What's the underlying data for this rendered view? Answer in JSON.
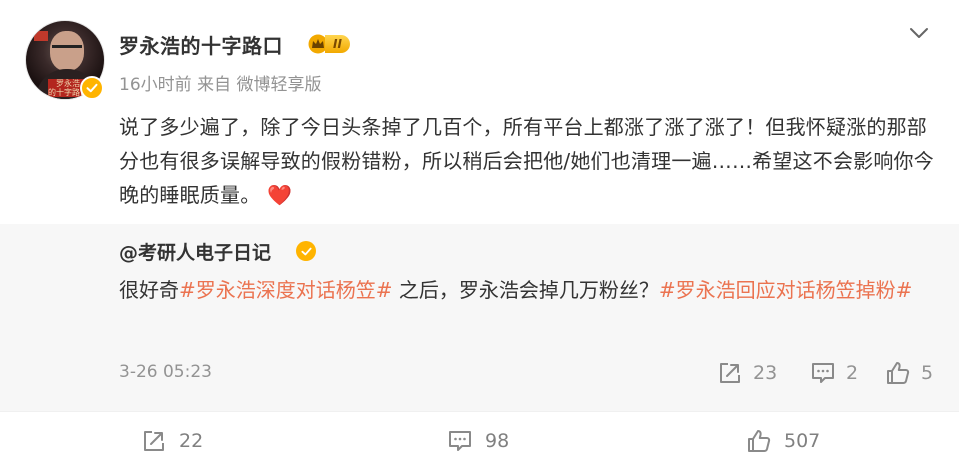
{
  "post": {
    "author": "罗永浩的十字路口",
    "vip_level": "II",
    "avatar_caption": "罗永浩\n的十字路口",
    "time": "16小时前",
    "source": "来自 微博轻享版",
    "text": "说了多少遍了，除了今日头条掉了几百个，所有平台上都涨了涨了涨了！但我怀疑涨的那部分也有很多误解导致的假粉错粉，所以稍后会把他/她们也清理一遍……希望这不会影响你今晚的睡眠质量。",
    "emoji": "❤️"
  },
  "retweet": {
    "author": "@考研人电子日记",
    "text_before": "很好奇",
    "topic1": "#罗永浩深度对话杨笠#",
    "text_middle": " 之后，罗永浩会掉几万粉丝？",
    "topic2": "#罗永浩回应对话杨笠掉粉#",
    "timestamp": "3-26 05:23",
    "reposts": "23",
    "comments": "2",
    "likes": "5"
  },
  "footer": {
    "reposts": "22",
    "comments": "98",
    "likes": "507"
  },
  "colors": {
    "topic": "#eb7350",
    "verified": "#ffb400",
    "meta_gray": "#939393",
    "retweet_bg": "#f7f7f7"
  },
  "icons": [
    "chevron-down-icon",
    "verified-icon",
    "vip-crown-icon",
    "repost-icon",
    "comment-icon",
    "like-icon"
  ]
}
